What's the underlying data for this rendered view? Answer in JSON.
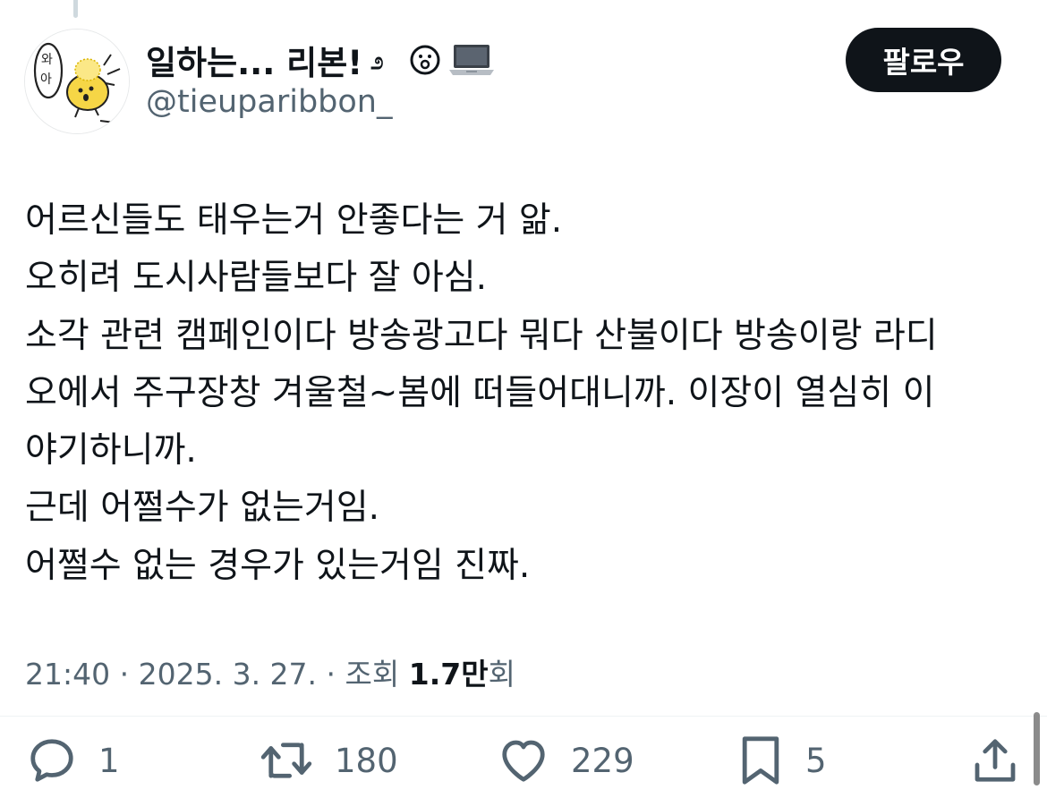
{
  "author": {
    "display_name": "일하는... 리본!",
    "handle": "@tieuparibbon_",
    "avatar_text": [
      "와",
      "아"
    ]
  },
  "follow_button": {
    "label": "팔로우"
  },
  "tweet": {
    "lines": [
      "어르신들도 태우는거 안좋다는 거 앎.",
      "오히려 도시사람들보다 잘 아심.",
      "소각 관련 캠페인이다 방송광고다 뭐다 산불이다 방송이랑 라디",
      "오에서 주구장창 겨울철~봄에 떠들어대니까. 이장이 열심히 이",
      "야기하니까.",
      "근데 어쩔수가 없는거임.",
      "어쩔수 없는 경우가 있는거임 진짜."
    ]
  },
  "meta": {
    "time": "21:40",
    "date": "2025. 3. 27.",
    "views_label": "조회",
    "views_count": "1.7만",
    "views_suffix": "회",
    "separator": "·"
  },
  "actions": {
    "reply_count": "1",
    "retweet_count": "180",
    "like_count": "229",
    "bookmark_count": "5"
  },
  "colors": {
    "text": "#0f1419",
    "secondary": "#536471",
    "button_bg": "#0f1419"
  }
}
